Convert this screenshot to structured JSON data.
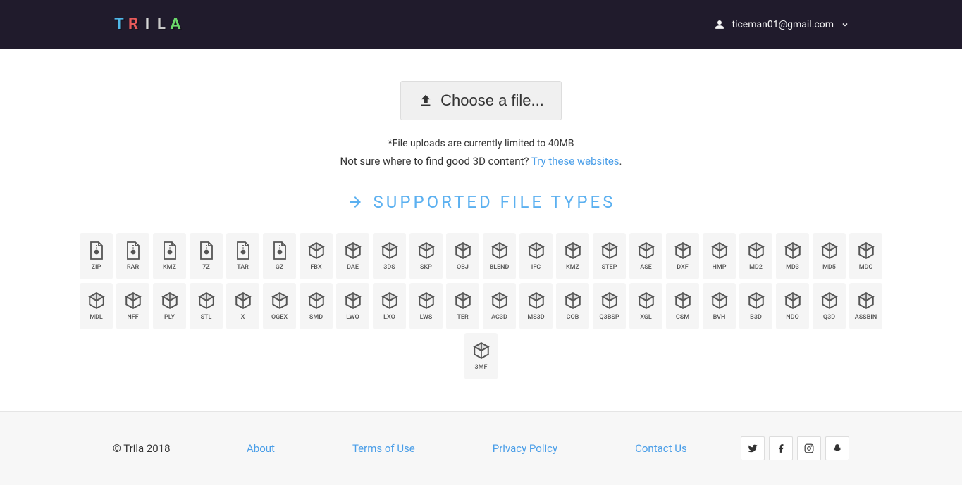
{
  "header": {
    "logo_text": "TRILA",
    "user_email": "ticeman01@gmail.com"
  },
  "main": {
    "choose_label": "Choose a file...",
    "limit_note": "*File uploads are currently limited to 40MB",
    "find_note_pre": "Not sure where to find good 3D content? ",
    "find_note_link": "Try these websites",
    "find_note_post": ".",
    "supported_title": "SUPPORTED FILE TYPES",
    "file_types": [
      {
        "label": "ZIP",
        "icon": "archive"
      },
      {
        "label": "RAR",
        "icon": "archive"
      },
      {
        "label": "KMZ",
        "icon": "archive"
      },
      {
        "label": "7Z",
        "icon": "archive"
      },
      {
        "label": "TAR",
        "icon": "archive"
      },
      {
        "label": "GZ",
        "icon": "archive"
      },
      {
        "label": "FBX",
        "icon": "cube"
      },
      {
        "label": "DAE",
        "icon": "cube"
      },
      {
        "label": "3DS",
        "icon": "cube"
      },
      {
        "label": "SKP",
        "icon": "cube"
      },
      {
        "label": "OBJ",
        "icon": "cube"
      },
      {
        "label": "BLEND",
        "icon": "cube"
      },
      {
        "label": "IFC",
        "icon": "cube"
      },
      {
        "label": "KMZ",
        "icon": "cube"
      },
      {
        "label": "STEP",
        "icon": "cube"
      },
      {
        "label": "ASE",
        "icon": "cube"
      },
      {
        "label": "DXF",
        "icon": "cube"
      },
      {
        "label": "HMP",
        "icon": "cube"
      },
      {
        "label": "MD2",
        "icon": "cube"
      },
      {
        "label": "MD3",
        "icon": "cube"
      },
      {
        "label": "MD5",
        "icon": "cube"
      },
      {
        "label": "MDC",
        "icon": "cube"
      },
      {
        "label": "MDL",
        "icon": "cube"
      },
      {
        "label": "NFF",
        "icon": "cube"
      },
      {
        "label": "PLY",
        "icon": "cube"
      },
      {
        "label": "STL",
        "icon": "cube"
      },
      {
        "label": "X",
        "icon": "cube"
      },
      {
        "label": "OGEX",
        "icon": "cube"
      },
      {
        "label": "SMD",
        "icon": "cube"
      },
      {
        "label": "LWO",
        "icon": "cube"
      },
      {
        "label": "LXO",
        "icon": "cube"
      },
      {
        "label": "LWS",
        "icon": "cube"
      },
      {
        "label": "TER",
        "icon": "cube"
      },
      {
        "label": "AC3D",
        "icon": "cube"
      },
      {
        "label": "MS3D",
        "icon": "cube"
      },
      {
        "label": "COB",
        "icon": "cube"
      },
      {
        "label": "Q3BSP",
        "icon": "cube"
      },
      {
        "label": "XGL",
        "icon": "cube"
      },
      {
        "label": "CSM",
        "icon": "cube"
      },
      {
        "label": "BVH",
        "icon": "cube"
      },
      {
        "label": "B3D",
        "icon": "cube"
      },
      {
        "label": "NDO",
        "icon": "cube"
      },
      {
        "label": "Q3D",
        "icon": "cube"
      },
      {
        "label": "ASSBIN",
        "icon": "cube"
      },
      {
        "label": "3MF",
        "icon": "cube"
      }
    ]
  },
  "footer": {
    "copyright": "© Trila 2018",
    "links": [
      {
        "label": "About"
      },
      {
        "label": "Terms of Use"
      },
      {
        "label": "Privacy Policy"
      },
      {
        "label": "Contact Us"
      }
    ],
    "social": [
      "twitter",
      "facebook",
      "instagram",
      "snapchat"
    ]
  },
  "logo_colors": [
    "#4fb8e8",
    "#e85a5a",
    "#d8d8d8",
    "#c8c8c8",
    "#6bd86b"
  ]
}
